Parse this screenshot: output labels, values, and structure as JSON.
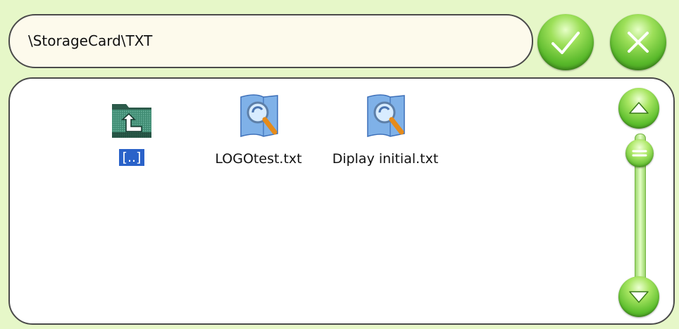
{
  "path_bar": {
    "path": "\\StorageCard\\TXT"
  },
  "toolbar": {
    "ok_icon": "checkmark-icon",
    "cancel_icon": "x-icon"
  },
  "files": [
    {
      "label": "[..]",
      "icon": "folder-up-icon",
      "selected": true
    },
    {
      "label": "LOGOtest.txt",
      "icon": "text-file-search-icon",
      "selected": false
    },
    {
      "label": "Diplay initial.txt",
      "icon": "text-file-search-icon",
      "selected": false
    }
  ],
  "scrollbar": {
    "position": 0.0
  },
  "colors": {
    "background": "#e6f7c8",
    "button_green": "#58b82a",
    "selection": "#2a62c9",
    "panel": "#ffffff"
  }
}
